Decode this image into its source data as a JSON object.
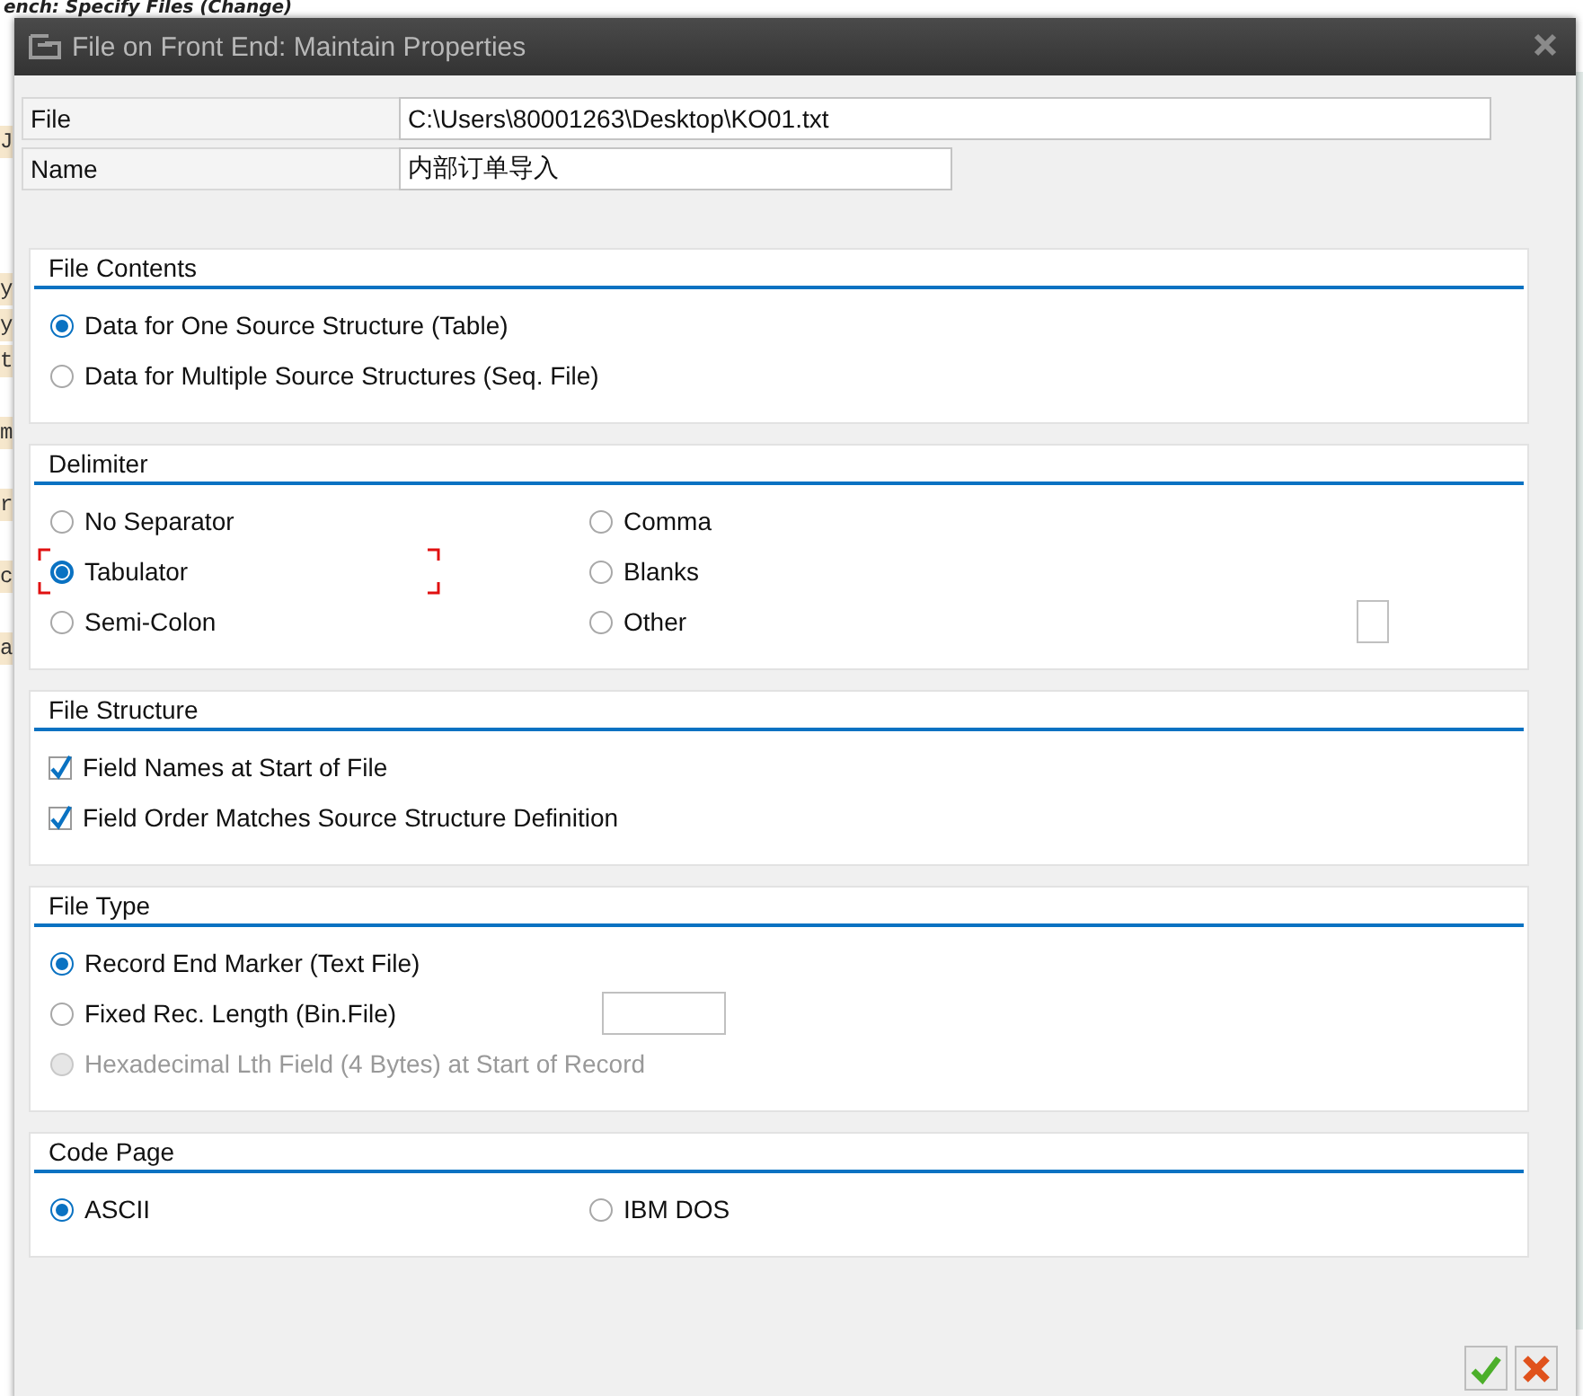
{
  "background": {
    "title": "ench: Specify Files (Change)",
    "fragments": [
      "J",
      "y",
      "y",
      "t",
      "m",
      "r",
      "c",
      "a"
    ]
  },
  "dialog": {
    "title": "File on Front End: Maintain Properties",
    "fields": [
      {
        "label": "File",
        "value": "C:\\Users\\80001263\\Desktop\\KO01.txt"
      },
      {
        "label": "Name",
        "value": "内部订单导入"
      }
    ],
    "sections": [
      {
        "title": "File Contents",
        "kind": "single",
        "items": [
          {
            "kind": "radio",
            "label": "Data for One Source Structure (Table)",
            "selected": true
          },
          {
            "kind": "radio",
            "label": "Data for Multiple Source Structures (Seq. File)",
            "selected": false
          }
        ]
      },
      {
        "title": "Delimiter",
        "kind": "double",
        "items": [
          {
            "kind": "radio",
            "label": "No Separator",
            "selected": false,
            "focused": false
          },
          {
            "kind": "radio",
            "label": "Comma",
            "selected": false,
            "focused": false
          },
          {
            "kind": "radio",
            "label": "Tabulator",
            "selected": true,
            "focused": true
          },
          {
            "kind": "radio",
            "label": "Blanks",
            "selected": false,
            "focused": false
          },
          {
            "kind": "radio",
            "label": "Semi-Colon",
            "selected": false,
            "focused": false
          },
          {
            "kind": "radio-field",
            "label": "Other",
            "selected": false,
            "focused": false
          }
        ]
      },
      {
        "title": "File Structure",
        "kind": "single",
        "items": [
          {
            "kind": "checkbox",
            "label": "Field Names at Start of File",
            "checked": true
          },
          {
            "kind": "checkbox",
            "label": "Field Order Matches Source Structure Definition",
            "checked": true
          }
        ]
      },
      {
        "title": "File Type",
        "kind": "single",
        "items": [
          {
            "kind": "radio",
            "label": "Record End Marker (Text File)",
            "selected": true,
            "disabled": false
          },
          {
            "kind": "radio-field",
            "label": "Fixed Rec. Length (Bin.File)",
            "selected": false,
            "disabled": false
          },
          {
            "kind": "radio",
            "label": "Hexadecimal Lth Field (4 Bytes) at Start of Record",
            "selected": false,
            "disabled": true
          }
        ]
      },
      {
        "title": "Code Page",
        "kind": "double",
        "items": [
          {
            "kind": "radio",
            "label": "ASCII",
            "selected": true
          },
          {
            "kind": "radio",
            "label": "IBM DOS",
            "selected": false
          }
        ]
      }
    ],
    "buttons": [
      {
        "kind": "confirm"
      },
      {
        "kind": "cancel"
      }
    ]
  }
}
